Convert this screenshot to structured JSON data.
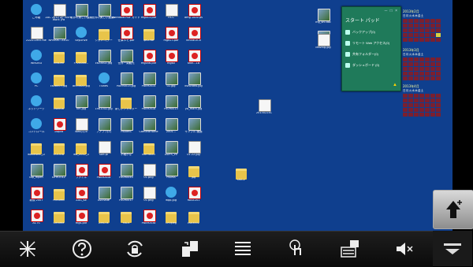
{
  "desktop": {
    "background": "#0f3f8e",
    "icons": [
      {
        "label": "ごみ箱",
        "type": "app"
      },
      {
        "label": "ZAC 2012 ZP 300% Work (Pa",
        "type": "doc"
      },
      {
        "label": "世界の美しい建築",
        "type": "img"
      },
      {
        "label": "世界の美しい建築2",
        "type": "img"
      },
      {
        "label": "Microsoft PDF ガイド",
        "type": "pdf"
      },
      {
        "label": "mg013.pdf",
        "type": "pdf"
      },
      {
        "label": "FICC",
        "type": "doc"
      },
      {
        "label": "amg 1000 ps",
        "type": "pdf"
      },
      {
        "label": "ZZZZ-Lmcl-file",
        "type": "doc"
      },
      {
        "label": "NPMAIS...ZA10",
        "type": "img"
      },
      {
        "label": "SkyDrive",
        "type": "app"
      },
      {
        "label": "シガン...(デー",
        "type": "folder"
      },
      {
        "label": "仕事メモ.pdf",
        "type": "pdf"
      },
      {
        "label": "lpc2.Ne",
        "type": "folder"
      },
      {
        "label": "mge23.pdf",
        "type": "pdf"
      },
      {
        "label": "kindle-in-a",
        "type": "pdf"
      },
      {
        "label": "WinDVD",
        "type": "app"
      },
      {
        "label": "hitsumi",
        "type": "folder"
      },
      {
        "label": "FY2008R...",
        "type": "folder"
      },
      {
        "label": "cs03002.jpg",
        "type": "img"
      },
      {
        "label": "世界一周観光",
        "type": "img"
      },
      {
        "label": "mg056.pdf",
        "type": "pdf"
      },
      {
        "label": "mg60",
        "type": "pdf"
      },
      {
        "label": "tzkh...18",
        "type": "pdf"
      },
      {
        "label": "PC",
        "type": "app"
      },
      {
        "label": "cs0b003.jpg",
        "type": "folder"
      },
      {
        "label": "aE03022.jpg",
        "type": "folder"
      },
      {
        "label": "iTunes",
        "type": "app"
      },
      {
        "label": "PA090013.jpg",
        "type": "img"
      },
      {
        "label": "P8090014",
        "type": "img"
      },
      {
        "label": "02.jpg",
        "type": "img"
      },
      {
        "label": "dvdvideo.jpg",
        "type": "img"
      },
      {
        "label": "ネットワーク",
        "type": "app"
      },
      {
        "label": "cs0008",
        "type": "folder"
      },
      {
        "label": "hm.jpg",
        "type": "img"
      },
      {
        "label": "1981002.jpg",
        "type": "img"
      },
      {
        "label": "新しいフォルダー",
        "type": "folder"
      },
      {
        "label": "P8090018",
        "type": "img"
      },
      {
        "label": "P8090015",
        "type": "img"
      },
      {
        "label": "yo_mark.jpg",
        "type": "img"
      },
      {
        "label": "コントロール",
        "type": "app"
      },
      {
        "label": "1stpdt",
        "type": "pdf"
      },
      {
        "label": "web(1).b",
        "type": "doc"
      },
      {
        "label": "フアフワ(2)",
        "type": "img"
      },
      {
        "label": "P80ImS",
        "type": "img"
      },
      {
        "label": "CameraHome",
        "type": "img"
      },
      {
        "label": "2001...",
        "type": "img"
      },
      {
        "label": "サンプル 画面",
        "type": "img"
      },
      {
        "label": "waveNMC_D",
        "type": "folder"
      },
      {
        "label": "OOOOD",
        "type": "folder"
      },
      {
        "label": "wd_2012_0",
        "type": "folder"
      },
      {
        "label": "sort.pl",
        "type": "doc"
      },
      {
        "label": "不確かな",
        "type": "img"
      },
      {
        "label": "BRYYBOU",
        "type": "folder"
      },
      {
        "label": "AWFS_v0",
        "type": "img"
      },
      {
        "label": "01.22.jpg",
        "type": "doc"
      },
      {
        "label": "tap_mpeh",
        "type": "img"
      },
      {
        "label": "NYHOOL2",
        "type": "img"
      },
      {
        "label": "ファイル",
        "type": "pdf"
      },
      {
        "label": "P8090016",
        "type": "pdf"
      },
      {
        "label": "P8090040",
        "type": "img"
      },
      {
        "label": "01.png",
        "type": "doc"
      },
      {
        "label": "P809A",
        "type": "img"
      },
      {
        "label": "jpg",
        "type": "folder"
      },
      {
        "label": "新規 2007",
        "type": "pdf"
      },
      {
        "label": "Pictured",
        "type": "folder"
      },
      {
        "label": "ZAG_Ke",
        "type": "pdf"
      },
      {
        "label": "Avchade",
        "type": "img"
      },
      {
        "label": "P8090017",
        "type": "img"
      },
      {
        "label": "01.png",
        "type": "doc"
      },
      {
        "label": "wpp.jpg",
        "type": "app"
      },
      {
        "label": "RASE201",
        "type": "pdf"
      },
      {
        "label": "ACTS",
        "type": "pdf"
      },
      {
        "label": "Chrome",
        "type": "folder"
      },
      {
        "label": "mgs.pdf",
        "type": "pdf"
      },
      {
        "label": "ZIRCOL",
        "type": "folder"
      },
      {
        "label": "FACS",
        "type": "folder"
      },
      {
        "label": "P8090038",
        "type": "pdf"
      },
      {
        "label": "CH.tpeg",
        "type": "folder"
      },
      {
        "label": "cs03002",
        "type": "folder"
      },
      {
        "label": "MAZGOR",
        "type": "folder"
      }
    ],
    "extra_icons": [
      {
        "label": "mg_shi.doc",
        "type": "img"
      },
      {
        "label": "mgvax",
        "type": "img"
      },
      {
        "label": "leaving.jpg",
        "type": "doc"
      },
      {
        "label": "20130224C",
        "type": "doc"
      },
      {
        "label": "DSC2",
        "type": "folder"
      }
    ]
  },
  "startpad": {
    "title": "スタート パッド",
    "controls": "─ □ ×",
    "items": [
      {
        "label": "バックアップ(0)",
        "icon": "backup-icon"
      },
      {
        "label": "リモート Web アクセス(0)",
        "icon": "remote-web-icon"
      },
      {
        "label": "共有フォルダー(0)",
        "icon": "shared-folder-icon"
      },
      {
        "label": "ダッシュボード (0)",
        "icon": "dashboard-icon"
      }
    ],
    "warning_icon": "alert-icon"
  },
  "calendars": [
    {
      "month": "2013年2月",
      "weekdays": "日月火水木金土"
    },
    {
      "month": "2013年3月",
      "weekdays": "日月火水木金土"
    },
    {
      "month": "2013年4月",
      "weekdays": "日月火水木金土"
    }
  ],
  "toolbar": {
    "buttons": [
      {
        "name": "cursor-off-button",
        "icon": "cursor-cross-icon"
      },
      {
        "name": "help-button",
        "icon": "question-icon"
      },
      {
        "name": "rotation-lock-button",
        "icon": "rotation-lock-icon"
      },
      {
        "name": "switch-screen-button",
        "icon": "screen-switch-icon"
      },
      {
        "name": "menu-button",
        "icon": "list-icon"
      },
      {
        "name": "touch-mode-button",
        "icon": "touch-icon"
      },
      {
        "name": "keyboard-button",
        "icon": "keyboard-text-icon"
      },
      {
        "name": "mute-button",
        "icon": "speaker-mute-icon"
      }
    ],
    "background": "#0a0a0a"
  },
  "side": {
    "up_button_icon": "hand-up-plus-icon",
    "collapse_icon": "collapse-down-icon"
  }
}
